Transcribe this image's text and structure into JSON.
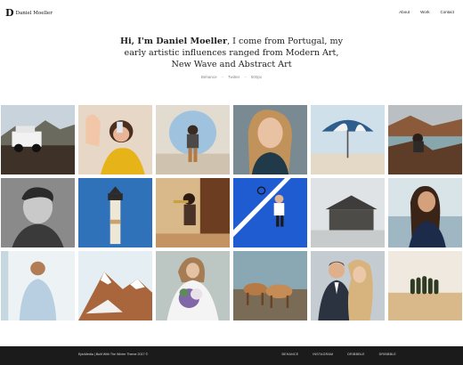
{
  "header": {
    "logo_mark": "D",
    "logo_text": "Daniel Moeller",
    "nav": [
      "About",
      "Work",
      "Contact"
    ]
  },
  "intro": {
    "greeting_bold": "Hi, I'm Daniel Moeller",
    "text": ", I come from Portugal, my early artistic influences ranged from Modern Art, New Wave and Abstract Art"
  },
  "social": [
    "Behance",
    "Twitter",
    "500px"
  ],
  "gallery": [
    {
      "name": "jeep-desert-photo",
      "kind": "jeep"
    },
    {
      "name": "girl-phone-photo",
      "kind": "phonegirl"
    },
    {
      "name": "man-circle-photo",
      "kind": "circleman"
    },
    {
      "name": "blonde-woman-photo",
      "kind": "blonde"
    },
    {
      "name": "beach-umbrella-photo",
      "kind": "umbrella"
    },
    {
      "name": "cliff-sitting-photo",
      "kind": "cliff"
    },
    {
      "name": "man-portrait-photo",
      "kind": "manbw"
    },
    {
      "name": "lighthouse-photo",
      "kind": "lighthouse"
    },
    {
      "name": "trumpet-player-photo",
      "kind": "trumpet"
    },
    {
      "name": "tennis-player-photo",
      "kind": "tennis"
    },
    {
      "name": "wooden-cabin-photo",
      "kind": "cabin"
    },
    {
      "name": "woman-beach-photo",
      "kind": "beachwoman"
    },
    {
      "name": "woman-back-photo",
      "kind": "back"
    },
    {
      "name": "snowy-mountain-photo",
      "kind": "mountain"
    },
    {
      "name": "bride-bouquet-photo",
      "kind": "bride"
    },
    {
      "name": "horses-photo",
      "kind": "horses"
    },
    {
      "name": "wedding-couple-photo",
      "kind": "couple"
    },
    {
      "name": "cypress-trees-photo",
      "kind": "trees"
    }
  ],
  "footer": {
    "copyright": "EpicMedia | Built With The Winter Theme 2017 ©",
    "links": [
      "BEHANCE",
      "INSTAGRAM",
      "DRIBBBLE",
      "DRIBBBLE"
    ]
  }
}
